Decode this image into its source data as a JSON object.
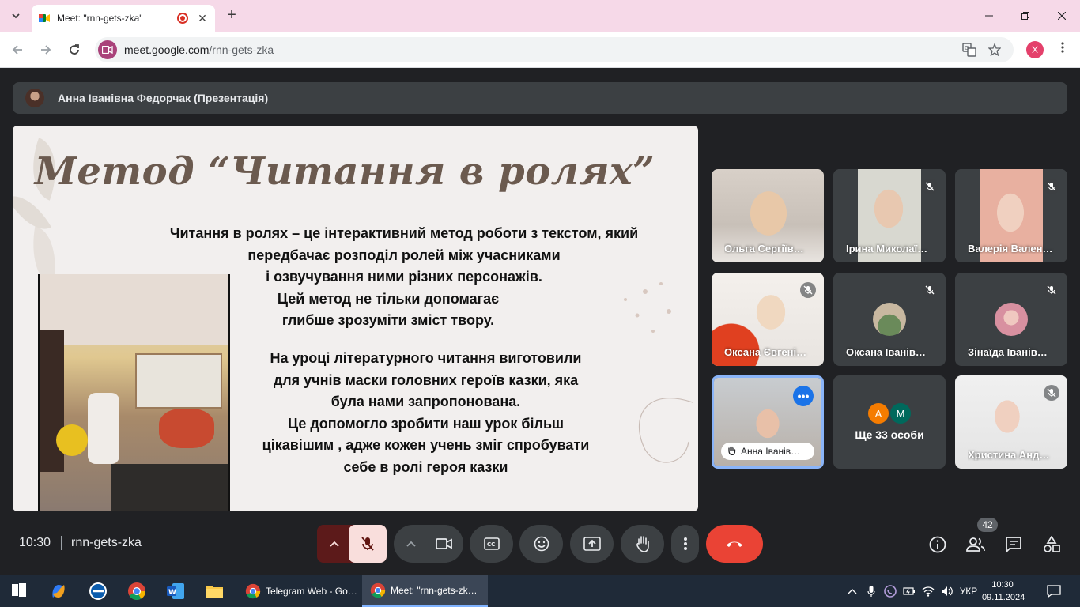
{
  "browser": {
    "tab_title": "Meet: \"rnn-gets-zka\"",
    "tab_close": "✕",
    "new_tab": "+",
    "url_host": "meet.google.com",
    "url_path": "/rnn-gets-zka",
    "profile_initial": "X"
  },
  "meet": {
    "presenter_label": "Анна Іванівна Федорчак (Презентація)",
    "slide": {
      "title": "Метод “Читання в ролях”",
      "paragraph1_lines": [
        "Читання в ролях – це інтерактивний метод роботи з текстом, який",
        "передбачає розподіл ролей між учасниками",
        "і озвучування ними різних персонажів.",
        "Цей метод не тільки допомагає",
        "глибше зрозуміти зміст твору."
      ],
      "paragraph2_lines": [
        "На уроці літературного читання виготовили",
        "для учнів маски головних героїв казки, яка",
        "була нами запропонована.",
        "Це допомогло зробити наш урок більш",
        "цікавішим , адже кожен учень зміг спробувати",
        "себе в ролі героя казки"
      ]
    },
    "participants": [
      {
        "name": "Ольга Сергіїв…",
        "muted": false
      },
      {
        "name": "Ірина Миколаї…",
        "muted": true
      },
      {
        "name": "Валерія Вален…",
        "muted": true
      },
      {
        "name": "Оксана Євгені…",
        "muted": true
      },
      {
        "name": "Оксана Іванів…",
        "muted": true
      },
      {
        "name": "Зінаїда Іванів…",
        "muted": true
      },
      {
        "name": "Анна Іванів…",
        "muted": false,
        "hand_raised": true
      },
      {
        "name": "Ще 33 особи",
        "avatars": [
          "А",
          "М"
        ]
      },
      {
        "name": "Христина Анд…",
        "muted": true
      }
    ],
    "footer": {
      "time": "10:30",
      "meeting_code": "rnn-gets-zka",
      "participants_count": "42"
    }
  },
  "taskbar": {
    "windows": [
      {
        "label": "Telegram Web - Go…",
        "active": false
      },
      {
        "label": "Meet: \"rnn-gets-zk…",
        "active": true
      }
    ],
    "language": "УКР",
    "clock_time": "10:30",
    "clock_date": "09.11.2024"
  },
  "colors": {
    "meet_bg": "#202124",
    "end_call": "#ea4335",
    "mic_off": "#f9dedc",
    "accent_blue": "#1a73e8",
    "tab_bar": "#f6d9e8"
  }
}
